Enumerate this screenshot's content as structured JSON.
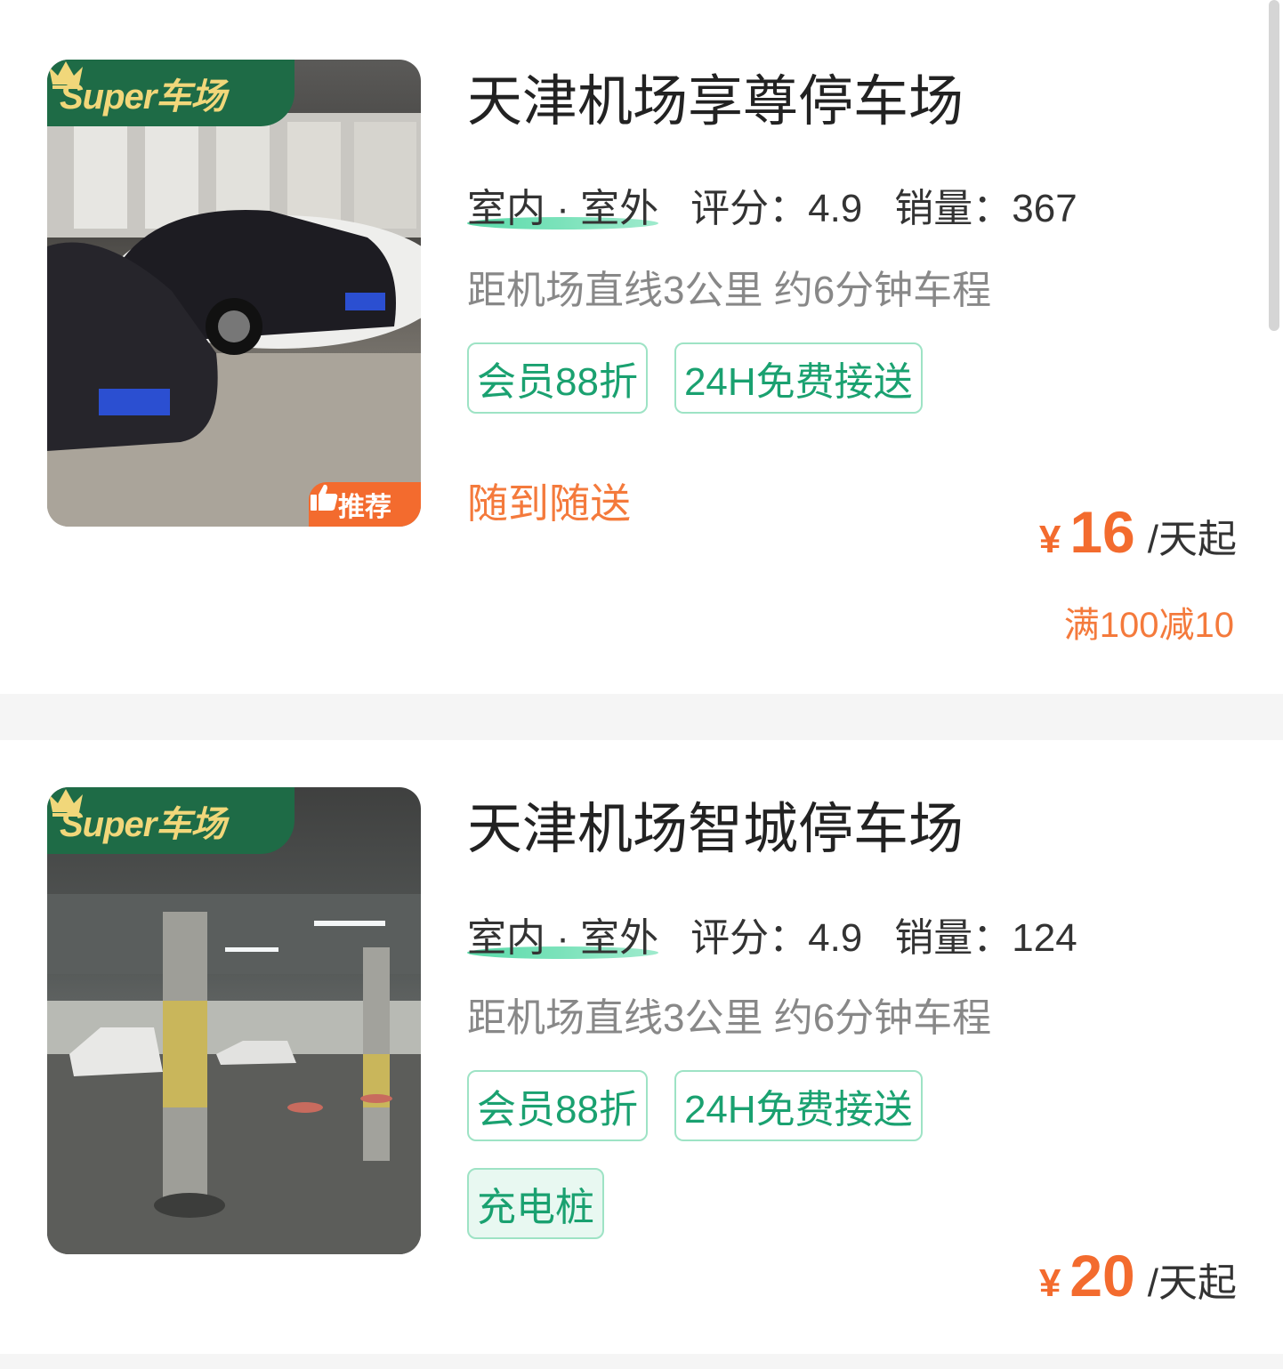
{
  "colors": {
    "accent_green": "#1aa170",
    "accent_orange": "#f36b2e",
    "badge_green": "#1e6b46",
    "badge_gold": "#f1d77a"
  },
  "lots": [
    {
      "badge": "Super车场",
      "recommend": "推荐",
      "name": "天津机场享尊停车场",
      "type": "室内 · 室外",
      "rating": "评分：4.9",
      "sales": "销量：367",
      "distance": "距机场直线3公里 约6分钟车程",
      "tags": [
        "会员88折",
        "24H免费接送"
      ],
      "service": "随到随送",
      "currency": "¥",
      "price": "16",
      "unit": "/天起",
      "discount": "满100减10"
    },
    {
      "badge": "Super车场",
      "name": "天津机场智城停车场",
      "type": "室内 · 室外",
      "rating": "评分：4.9",
      "sales": "销量：124",
      "distance": "距机场直线3公里 约6分钟车程",
      "tags": [
        "会员88折",
        "24H免费接送"
      ],
      "extra_tag": "充电桩",
      "currency": "¥",
      "price": "20",
      "unit": "/天起"
    }
  ]
}
